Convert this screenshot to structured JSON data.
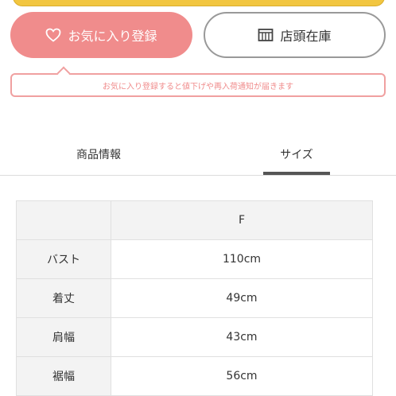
{
  "buttons": {
    "favorite_label": "お気に入り登録",
    "store_stock_label": "店頭在庫"
  },
  "notice": "お気に入り登録すると値下げや再入荷通知が届きます",
  "tabs": [
    {
      "label": "商品情報",
      "active": false
    },
    {
      "label": "サイズ",
      "active": true
    }
  ],
  "size_table": {
    "header": "F",
    "rows": [
      {
        "label": "バスト",
        "value": "110cm"
      },
      {
        "label": "着丈",
        "value": "49cm"
      },
      {
        "label": "肩幅",
        "value": "43cm"
      },
      {
        "label": "裾幅",
        "value": "56cm"
      }
    ]
  },
  "colors": {
    "accent_pink": "#f08c8c",
    "top_bar_yellow": "#f2c640",
    "table_label_bg": "#f3f3f3"
  }
}
